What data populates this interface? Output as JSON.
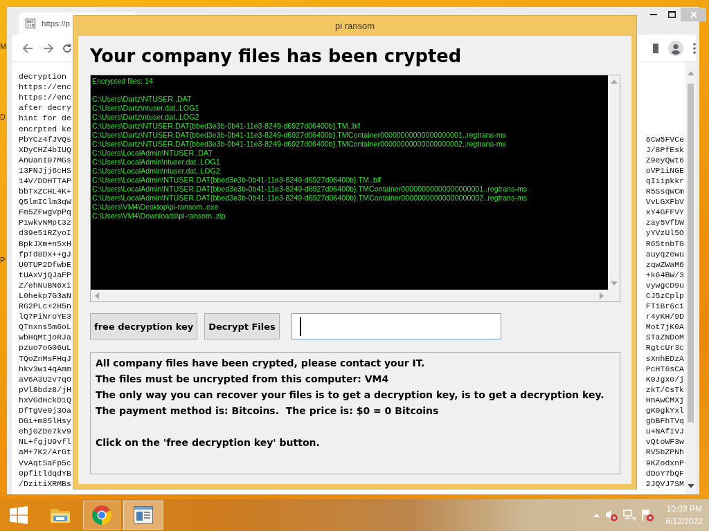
{
  "desktop_icons": [
    {
      "label": "M"
    },
    {
      "label": "D"
    },
    {
      "label": "P"
    }
  ],
  "browser": {
    "tab": {
      "title": "https://p"
    },
    "page_rows": [
      {
        "left": "decryption"
      },
      {
        "left": "https://enc"
      },
      {
        "left": "https://enc"
      },
      {
        "left": "after decry"
      },
      {
        "left": "hint for de"
      },
      {
        "left": "encrpted ke"
      },
      {
        "left": "PbYCz4fJVQs",
        "right": "6Cw5FVCe"
      },
      {
        "left": "XDyCHZ4bIUQ",
        "right": "J/8PfEsk"
      },
      {
        "left": "AnUanI07MGs",
        "right": "Z9eyQWt6"
      },
      {
        "left": "13FNJjj6cHS",
        "right": "oVP1iNGE"
      },
      {
        "left": "14V/DDHTTAP",
        "right": "qIiipkkr"
      },
      {
        "left": "bbTxZCHL4K+",
        "right": "R5SsqWCm"
      },
      {
        "left": "Q5lmIClm3qW",
        "right": "VvLGXFbV"
      },
      {
        "left": "Fm5ZFwgVpPq",
        "right": "xY4GFFVY"
      },
      {
        "left": "P1wkvNMpt3z",
        "right": "zay5VfbW"
      },
      {
        "left": "d39e51RZyoI",
        "right": "yYVzUl5O"
      },
      {
        "left": "BpkJXm+n5xH",
        "right": "R65tnbTG"
      },
      {
        "left": "fpTd8Dx++gJ",
        "right": "auyqzewu"
      },
      {
        "left": "U0TUP2DfwbE",
        "right": "zqwZWaM6"
      },
      {
        "left": "tUAxVjQJaFP",
        "right": "+k64BW/3"
      },
      {
        "left": "Z/ehNuBN6xi",
        "right": "vywgcD9u"
      },
      {
        "left": "L0hekp7G3aN",
        "right": "CJ5zCplp"
      },
      {
        "left": "RG2PLc+2H5n",
        "right": "FTiBr6ci"
      },
      {
        "left": "lQ7PiNroYE3",
        "right": "r4yKH/9D"
      },
      {
        "left": "QTnxns5m6oL",
        "right": "Mot7jK0A"
      },
      {
        "left": "wbHqMtjoRJa",
        "right": "STaZNDoM"
      },
      {
        "left": "pzuo7oG06uL",
        "right": "RgtcUr3c"
      },
      {
        "left": "TQoZnMsFHqJ",
        "right": "sXnhEDzA"
      },
      {
        "left": "hkv3wi4qAmm",
        "right": "PcHT6sCA"
      },
      {
        "left": "aV6A3U2v7qO",
        "right": "K0Jgx0/j"
      },
      {
        "left": "pVl8bdz8/jH",
        "right": "zkT/CsTk"
      },
      {
        "left": "hxVGdHckD1Q",
        "right": "HnAwCMXj"
      },
      {
        "left": "DfTgVe0j3Oa",
        "right": "gK0gkYxl"
      },
      {
        "left": "DGi+m85lHsy",
        "right": "gbBFhTVq"
      },
      {
        "left": "ehj0ZDe7kv9",
        "right": "u+NAfIVJ"
      },
      {
        "left": "NL+fgjU9vfl",
        "right": "vQtoWF3w"
      },
      {
        "left": "aM+7K2/ArGt",
        "right": "RV5bZPNh"
      },
      {
        "left": "VvAqtSaFp5c",
        "right": "9KZodxnP"
      },
      {
        "left": "0pfitldqdYB",
        "right": "dDoY7bQF"
      },
      {
        "left": "/DzitiXRMBs",
        "right": "2JQVJ7SM"
      }
    ]
  },
  "dialog": {
    "title": "pi ransom",
    "heading": "Your company files has been crypted",
    "log": {
      "summary": "Encrypted files: 14",
      "files": [
        "C:\\Users\\Dartz\\NTUSER..DAT",
        "C:\\Users\\Dartz\\ntuser.dat..LOG1",
        "C:\\Users\\Dartz\\ntuser.dat..LOG2",
        "C:\\Users\\Dartz\\NTUSER.DAT{bbed3e3b-0b41-11e3-8249-d6927d06400b}.TM..blf",
        "C:\\Users\\Dartz\\NTUSER.DAT{bbed3e3b-0b41-11e3-8249-d6927d06400b}.TMContainer00000000000000000001..regtrans-ms",
        "C:\\Users\\Dartz\\NTUSER.DAT{bbed3e3b-0b41-11e3-8249-d6927d06400b}.TMContainer00000000000000000002..regtrans-ms",
        "C:\\Users\\LocalAdmin\\NTUSER..DAT",
        "C:\\Users\\LocalAdmin\\ntuser.dat..LOG1",
        "C:\\Users\\LocalAdmin\\ntuser.dat..LOG2",
        "C:\\Users\\LocalAdmin\\NTUSER.DAT{bbed3e3b-0b41-11e3-8249-d6927d06400b}.TM..blf",
        "C:\\Users\\LocalAdmin\\NTUSER.DAT{bbed3e3b-0b41-11e3-8249-d6927d06400b}.TMContainer00000000000000000001..regtrans-ms",
        "C:\\Users\\LocalAdmin\\NTUSER.DAT{bbed3e3b-0b41-11e3-8249-d6927d06400b}.TMContainer00000000000000000002..regtrans-ms",
        "C:\\Users\\VM4\\Desktop\\pi-ransom..exe",
        "C:\\Users\\VM4\\Downloads\\pi-ransom..zip"
      ]
    },
    "buttons": [
      {
        "label": "free decryption key"
      },
      {
        "label": "Decrypt Files"
      }
    ],
    "key_input": {
      "focused": true
    },
    "message": [
      {
        "lines": [
          "All company files have been crypted, please contact your IT.",
          "The files must be uncrypted from this computer: VM4",
          "The only way you can recover your files is to get a decryption key, is to get a decryption key.",
          "The payment method is: Bitcoins.  The price is: $0 = 0 Bitcoins"
        ]
      },
      {
        "lines": [
          "Click on the 'free decryption key' button."
        ]
      }
    ]
  },
  "taskbar": {
    "apps": [
      {
        "kind": "explorer",
        "running": false,
        "selected": false
      },
      {
        "kind": "browser",
        "running": true,
        "selected": false
      },
      {
        "kind": "window",
        "running": true,
        "selected": true
      }
    ],
    "clock": {
      "time": "10:03 PM",
      "date": "6/12/2022"
    }
  }
}
